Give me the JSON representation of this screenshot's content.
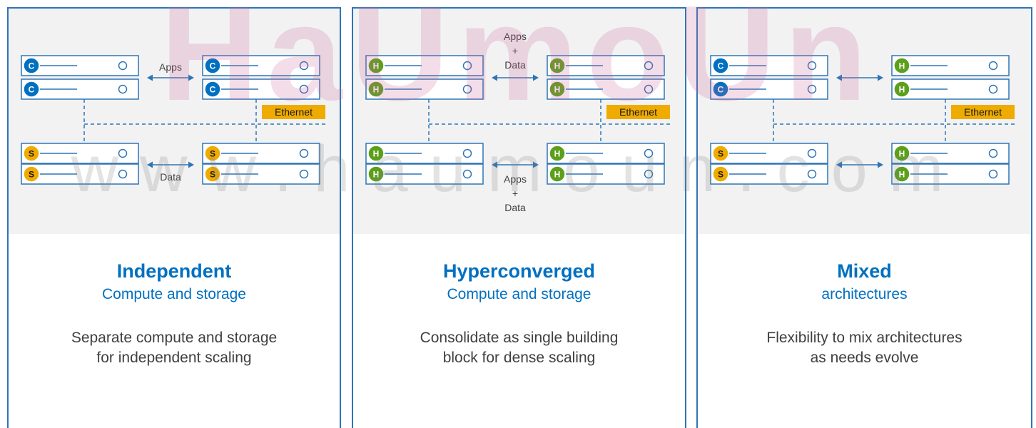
{
  "panels": [
    {
      "heading": "Independent",
      "subheading": "Compute and storage",
      "description": [
        "Separate compute and storage",
        "for independent scaling"
      ],
      "top_left": [
        "C",
        "C"
      ],
      "top_right": [
        "C",
        "C"
      ],
      "bottom_left": [
        "S",
        "S"
      ],
      "bottom_right": [
        "S",
        "S"
      ],
      "top_flow_label": [
        "Apps"
      ],
      "bottom_flow_label": [
        "Data"
      ],
      "ethernet_label": "Ethernet"
    },
    {
      "heading": "Hyperconverged",
      "subheading": "Compute and storage",
      "description": [
        "Consolidate as single building",
        "block for dense scaling"
      ],
      "top_left": [
        "H",
        "H"
      ],
      "top_right": [
        "H",
        "H"
      ],
      "bottom_left": [
        "H",
        "H"
      ],
      "bottom_right": [
        "H",
        "H"
      ],
      "top_flow_label": [
        "Apps",
        "+",
        "Data"
      ],
      "bottom_flow_label": [
        "Apps",
        "+",
        "Data"
      ],
      "ethernet_label": "Ethernet"
    },
    {
      "heading": "Mixed",
      "subheading": "architectures",
      "description": [
        "Flexibility to mix architectures",
        "as needs evolve"
      ],
      "top_left": [
        "C",
        "C"
      ],
      "top_right": [
        "H",
        "H"
      ],
      "bottom_left": [
        "S",
        "S"
      ],
      "bottom_right": [
        "H",
        "H"
      ],
      "top_flow_label": [],
      "bottom_flow_label": [],
      "ethernet_label": "Ethernet"
    }
  ],
  "watermark": {
    "top": "HaUmoUn",
    "bottom": "www.haumoun.com"
  },
  "colors": {
    "compute": "#0070c0",
    "storage": "#f0ab00",
    "hyperconverged": "#5b9f1a",
    "panel_border": "#2e75b6",
    "ethernet": "#f0ab00",
    "arrow": "#2e75b6",
    "dashed_line": "#2e75b6"
  }
}
